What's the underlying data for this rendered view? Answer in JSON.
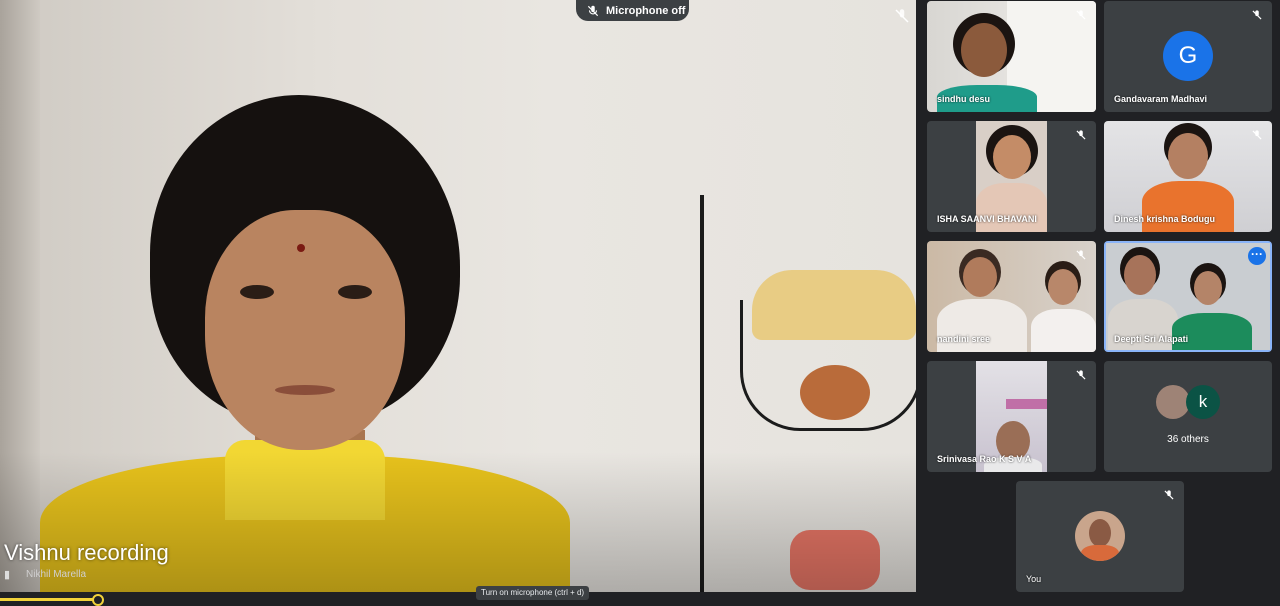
{
  "main": {
    "title": "Vishnu recording",
    "subname": "Nikhil Marella"
  },
  "mic_banner": {
    "label": "Microphone off",
    "icon": "mic-off-icon"
  },
  "tiles": [
    {
      "name": "sindhu desu",
      "muted": true
    },
    {
      "name": "Gandavaram Madhavi",
      "avatar_letter": "G",
      "avatar_color": "#1a73e8",
      "muted": true
    },
    {
      "name": "ISHA SAANVI BHAVANI",
      "muted": true
    },
    {
      "name": "Dinesh krishna Bodugu",
      "muted": true
    },
    {
      "name": "nandini sree",
      "muted": true
    },
    {
      "name": "Deepti Sri Alapati",
      "muted": false,
      "more_icon": "more-options-icon"
    },
    {
      "name": "Srinivasa Rao K S V A",
      "muted": true
    },
    {
      "name": "36 others",
      "avatar_letter": "k",
      "avatar_color": "#0b5345"
    },
    {
      "name": "You",
      "muted": true
    }
  ],
  "tooltip": "Turn on microphone (ctrl + d)",
  "colors": {
    "tile_bg": "#3c4043",
    "page_bg": "#202124",
    "accent": "#1a73e8",
    "progress": "#f1d23a"
  }
}
